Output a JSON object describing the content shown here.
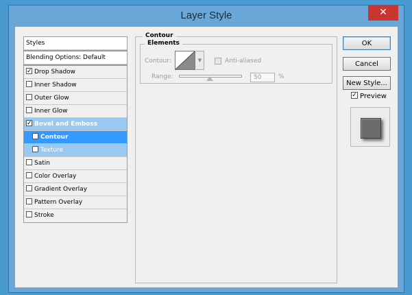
{
  "window": {
    "title": "Layer Style",
    "close_glyph": "✕"
  },
  "styles": {
    "header": "Styles",
    "blending_options": "Blending Options: Default",
    "items": [
      {
        "label": "Drop Shadow",
        "checked": true
      },
      {
        "label": "Inner Shadow",
        "checked": false
      },
      {
        "label": "Outer Glow",
        "checked": false
      },
      {
        "label": "Inner Glow",
        "checked": false
      },
      {
        "label": "Bevel and Emboss",
        "checked": true,
        "selected": true
      },
      {
        "label": "Contour",
        "checked": false,
        "selected": true
      },
      {
        "label": "Texture",
        "checked": false
      },
      {
        "label": "Satin",
        "checked": false
      },
      {
        "label": "Color Overlay",
        "checked": false
      },
      {
        "label": "Gradient Overlay",
        "checked": false
      },
      {
        "label": "Pattern Overlay",
        "checked": false
      },
      {
        "label": "Stroke",
        "checked": false
      }
    ]
  },
  "contour_panel": {
    "legend": "Contour",
    "elements_legend": "Elements",
    "contour_label": "Contour:",
    "anti_aliased_label": "Anti-aliased",
    "range_label": "Range:",
    "range_value": "50",
    "range_unit": "%",
    "range_fraction": 0.5
  },
  "buttons": {
    "ok": "OK",
    "cancel": "Cancel",
    "new_style": "New Style...",
    "preview_label": "Preview",
    "preview_checked": true
  },
  "colors": {
    "selected_row": "#3399ff",
    "selected_parent": "#99c9f0",
    "close_button": "#c7372f"
  }
}
